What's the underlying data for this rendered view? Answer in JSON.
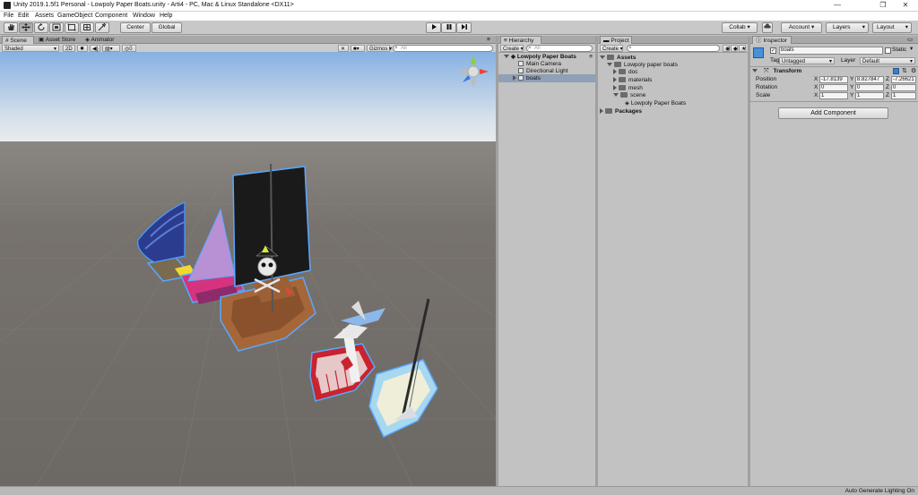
{
  "window": {
    "title": "Unity 2019.1.5f1 Personal - Lowpoly Paper Boats.unity - Arti4 - PC, Mac & Linux Standalone <DX11>",
    "controls": [
      "—",
      "❐",
      "✕"
    ]
  },
  "menu": [
    "File",
    "Edit",
    "Assets",
    "GameObject",
    "Component",
    "Window",
    "Help"
  ],
  "toolbar": {
    "pivot_label": "Center",
    "space_label": "Global",
    "collab_label": "Collab ▾",
    "account_label": "Account ▾",
    "layers_label": "Layers",
    "layout_label": "Layout"
  },
  "scene_panel": {
    "tabs": [
      "Scene",
      "Asset Store",
      "Animator"
    ],
    "shading": "Shaded",
    "mode_2d": "2D",
    "fx_count": "0",
    "gizmos_label": "Gizmos ▾",
    "search_placeholder": "All"
  },
  "hierarchy": {
    "tab": "Hierarchy",
    "create_label": "Create ▾",
    "search_placeholder": "All",
    "scene_name": "Lowpoly Paper Boats",
    "items": [
      "Main Camera",
      "Directional Light",
      "boats"
    ]
  },
  "project": {
    "tab": "Project",
    "create_label": "Create ▾",
    "tree": {
      "assets": "Assets",
      "pack": "Lowpoly paper boats",
      "folders": [
        "doc",
        "materials",
        "mesh",
        "scene"
      ],
      "scene_asset": "Lowpoly Paper Boats",
      "packages": "Packages"
    }
  },
  "inspector": {
    "tab": "Inspector",
    "object_name": "boats",
    "static_label": "Static",
    "tag_label": "Tag",
    "tag_value": "Untagged",
    "layer_label": "Layer",
    "layer_value": "Default",
    "component_title": "Transform",
    "position": {
      "label": "Position",
      "x": "-17.8139",
      "y": "8.827847",
      "z": "-7.26621"
    },
    "rotation": {
      "label": "Rotation",
      "x": "0",
      "y": "0",
      "z": "0"
    },
    "scale": {
      "label": "Scale",
      "x": "1",
      "y": "1",
      "z": "1"
    },
    "axis_labels": [
      "X",
      "Y",
      "Z"
    ],
    "add_component_label": "Add Component"
  },
  "status": {
    "text": "Auto Generate Lighting On"
  },
  "colors": {
    "editor_bg": "#c2c2c2",
    "sky_top": "#8ab4e2",
    "ground": "#6f6b67",
    "selection": "#8fa0b7",
    "accent_blue": "#3a7bd5"
  }
}
